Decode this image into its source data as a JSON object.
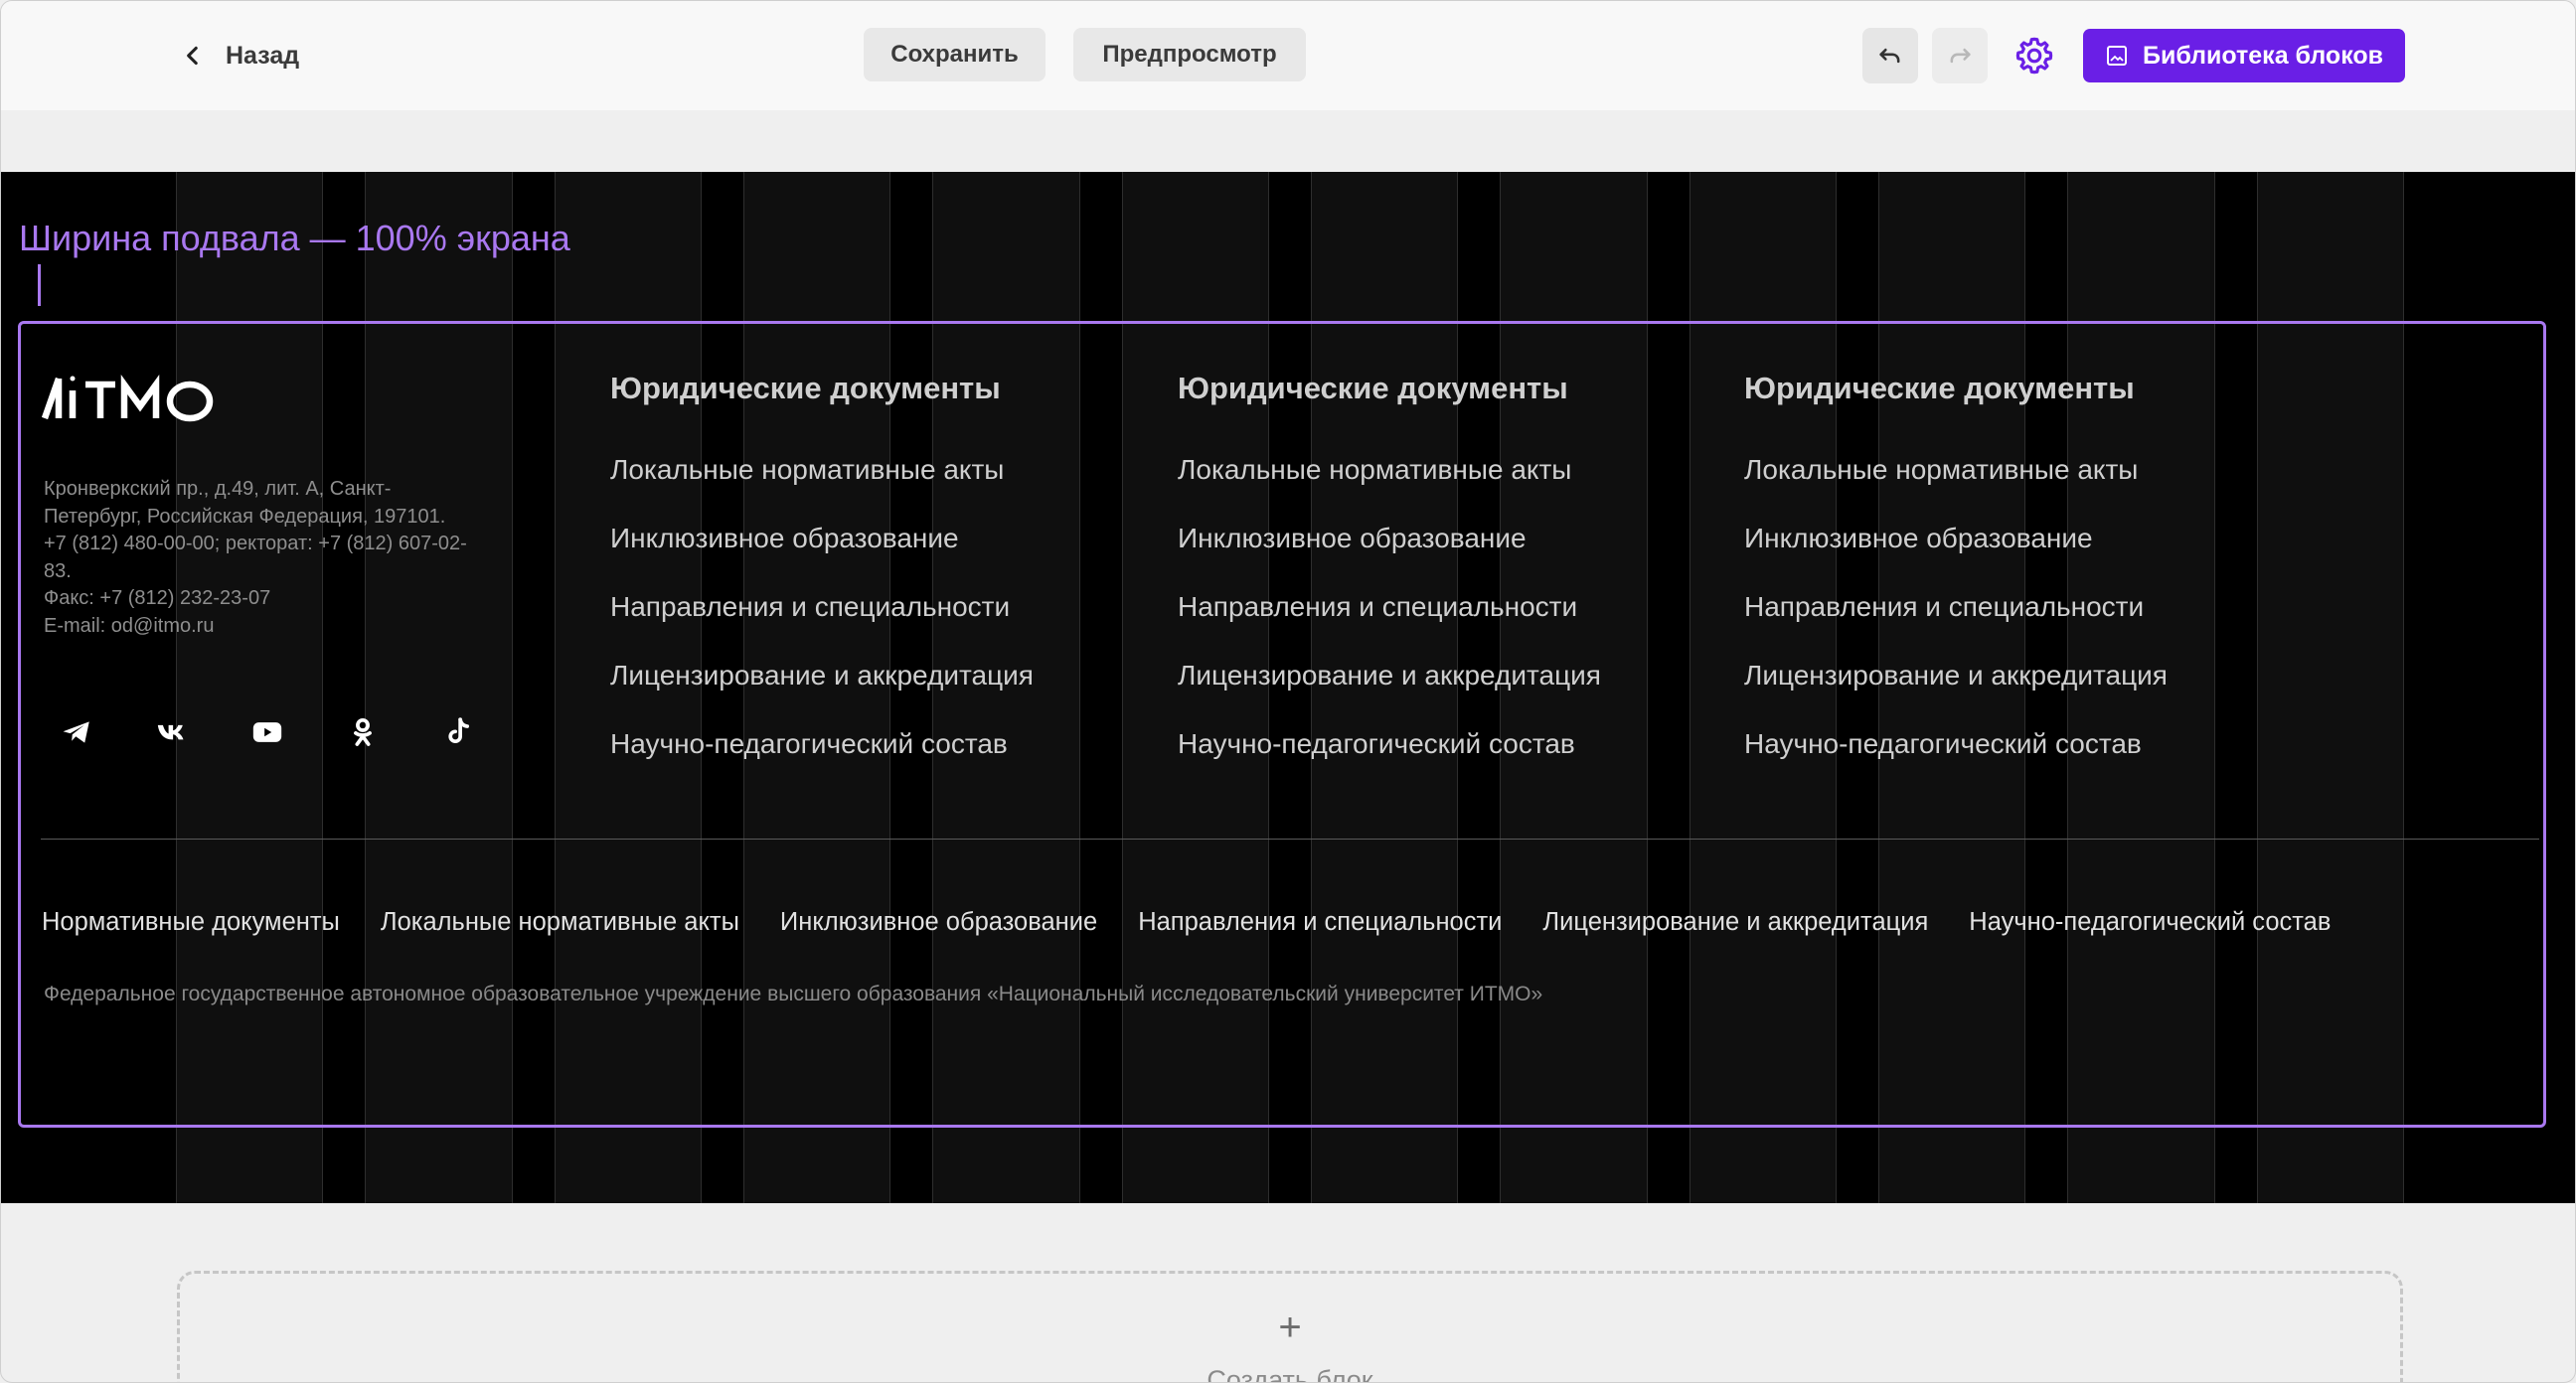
{
  "topbar": {
    "back_label": "Назад",
    "save_label": "Сохранить",
    "preview_label": "Предпросмотр",
    "library_label": "Библиотека блоков",
    "accent_color": "#6a1fe6"
  },
  "canvas": {
    "guide_label": "Ширина подвала — 100% экрана",
    "guide_color": "#a978f0"
  },
  "footer": {
    "logo_text": "ИТМО",
    "address_lines": [
      "Кронверкский пр., д.49, лит. А, Санкт-",
      "Петербург, Российская Федерация, 197101.",
      "+7 (812) 480-00-00; ректорат: +7 (812) 607-02-",
      "83.",
      "Факс: +7 (812) 232-23-07",
      "E-mail: od@itmo.ru"
    ],
    "socials": [
      "telegram-icon",
      "vk-icon",
      "youtube-icon",
      "odnoklassniki-icon",
      "tiktok-icon"
    ],
    "columns": [
      {
        "title": "Юридические документы",
        "links": [
          "Локальные нормативные акты",
          "Инклюзивное образование",
          "Направления и специальности",
          "Лицензирование и аккредитация",
          "Научно-педагогический состав"
        ]
      },
      {
        "title": "Юридические документы",
        "links": [
          "Локальные нормативные акты",
          "Инклюзивное образование",
          "Направления и специальности",
          "Лицензирование и аккредитация",
          "Научно-педагогический состав"
        ]
      },
      {
        "title": "Юридические документы",
        "links": [
          "Локальные нормативные акты",
          "Инклюзивное образование",
          "Направления и специальности",
          "Лицензирование и аккредитация",
          "Научно-педагогический состав"
        ]
      }
    ],
    "bottom_links": [
      "Нормативные документы",
      "Локальные нормативные акты",
      "Инклюзивное образование",
      "Направления и специальности",
      "Лицензирование и аккредитация",
      "Научно-педагогический состав"
    ],
    "legal": "Федеральное государственное автономное образовательное учреждение высшего образования «Национальный исследовательский университет ИТМО»"
  },
  "create_block": {
    "plus": "+",
    "label": "Создать блок"
  }
}
